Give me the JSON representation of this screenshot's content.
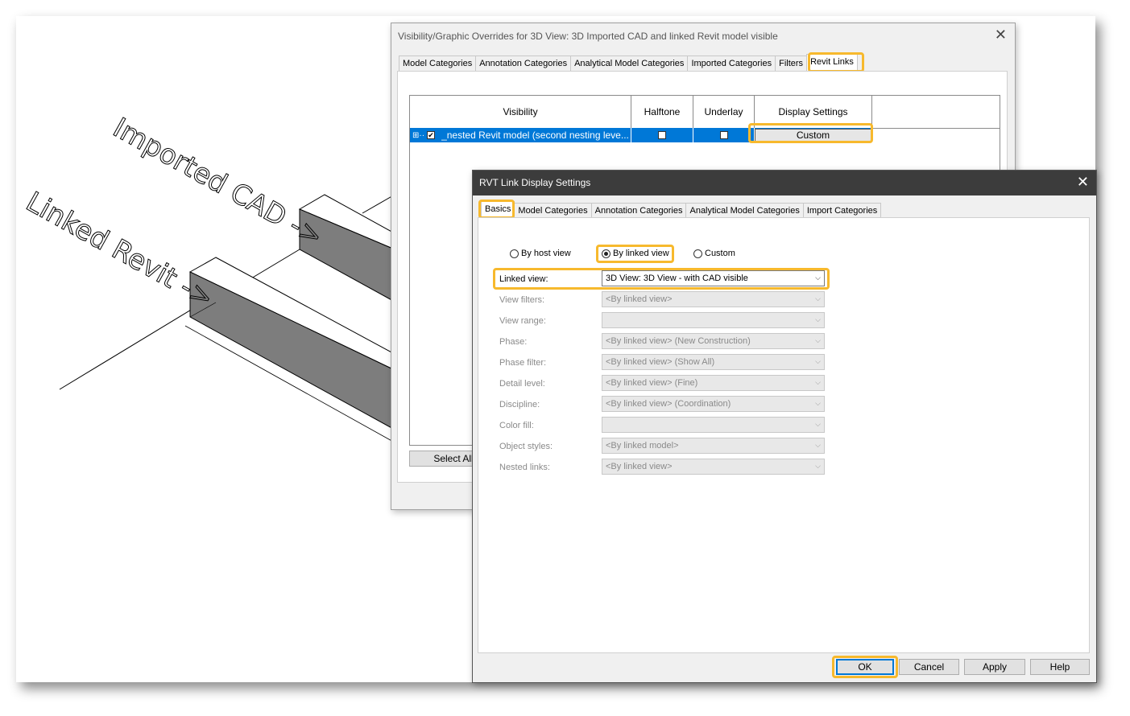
{
  "viewport": {
    "labels": [
      "Imported CAD ->",
      "Linked Revit ->"
    ]
  },
  "vg_dialog": {
    "title": "Visibility/Graphic Overrides for 3D View: 3D Imported CAD and linked Revit model visible",
    "close_glyph": "✕",
    "tabs": [
      "Model Categories",
      "Annotation Categories",
      "Analytical Model Categories",
      "Imported Categories",
      "Filters",
      "Revit Links"
    ],
    "active_tab": "Revit Links",
    "columns": [
      "Visibility",
      "Halftone",
      "Underlay",
      "Display Settings"
    ],
    "row": {
      "expander": "⊞",
      "name": "_nested Revit model (second nesting leve...",
      "visible": true,
      "halftone": false,
      "underlay": false,
      "display_settings": "Custom"
    },
    "select_all_label": "Select All"
  },
  "rvt_dialog": {
    "title": "RVT Link Display Settings",
    "close_glyph": "✕",
    "tabs": [
      "Basics",
      "Model Categories",
      "Annotation Categories",
      "Analytical Model Categories",
      "Import Categories"
    ],
    "active_tab": "Basics",
    "radios": [
      {
        "label": "By host view",
        "checked": false
      },
      {
        "label": "By linked view",
        "checked": true
      },
      {
        "label": "Custom",
        "checked": false
      }
    ],
    "fields": [
      {
        "label": "Linked view:",
        "value": "3D View: 3D View - with CAD visible",
        "enabled": true
      },
      {
        "label": "View filters:",
        "value": "<By linked view>",
        "enabled": false
      },
      {
        "label": "View range:",
        "value": "",
        "enabled": false
      },
      {
        "label": "Phase:",
        "value": "<By linked view> (New Construction)",
        "enabled": false
      },
      {
        "label": "Phase filter:",
        "value": "<By linked view> (Show All)",
        "enabled": false
      },
      {
        "label": "Detail level:",
        "value": "<By linked view> (Fine)",
        "enabled": false
      },
      {
        "label": "Discipline:",
        "value": "<By linked view> (Coordination)",
        "enabled": false
      },
      {
        "label": "Color fill:",
        "value": "",
        "enabled": false
      },
      {
        "label": "Object styles:",
        "value": "<By linked model>",
        "enabled": false
      },
      {
        "label": "Nested links:",
        "value": "<By linked view>",
        "enabled": false
      }
    ],
    "chevron_glyph": "⌵",
    "buttons": [
      "OK",
      "Cancel",
      "Apply",
      "Help"
    ]
  },
  "colors": {
    "highlight": "#f7b92d",
    "selection": "#0078d7",
    "titlebar": "#3c3c3c"
  }
}
